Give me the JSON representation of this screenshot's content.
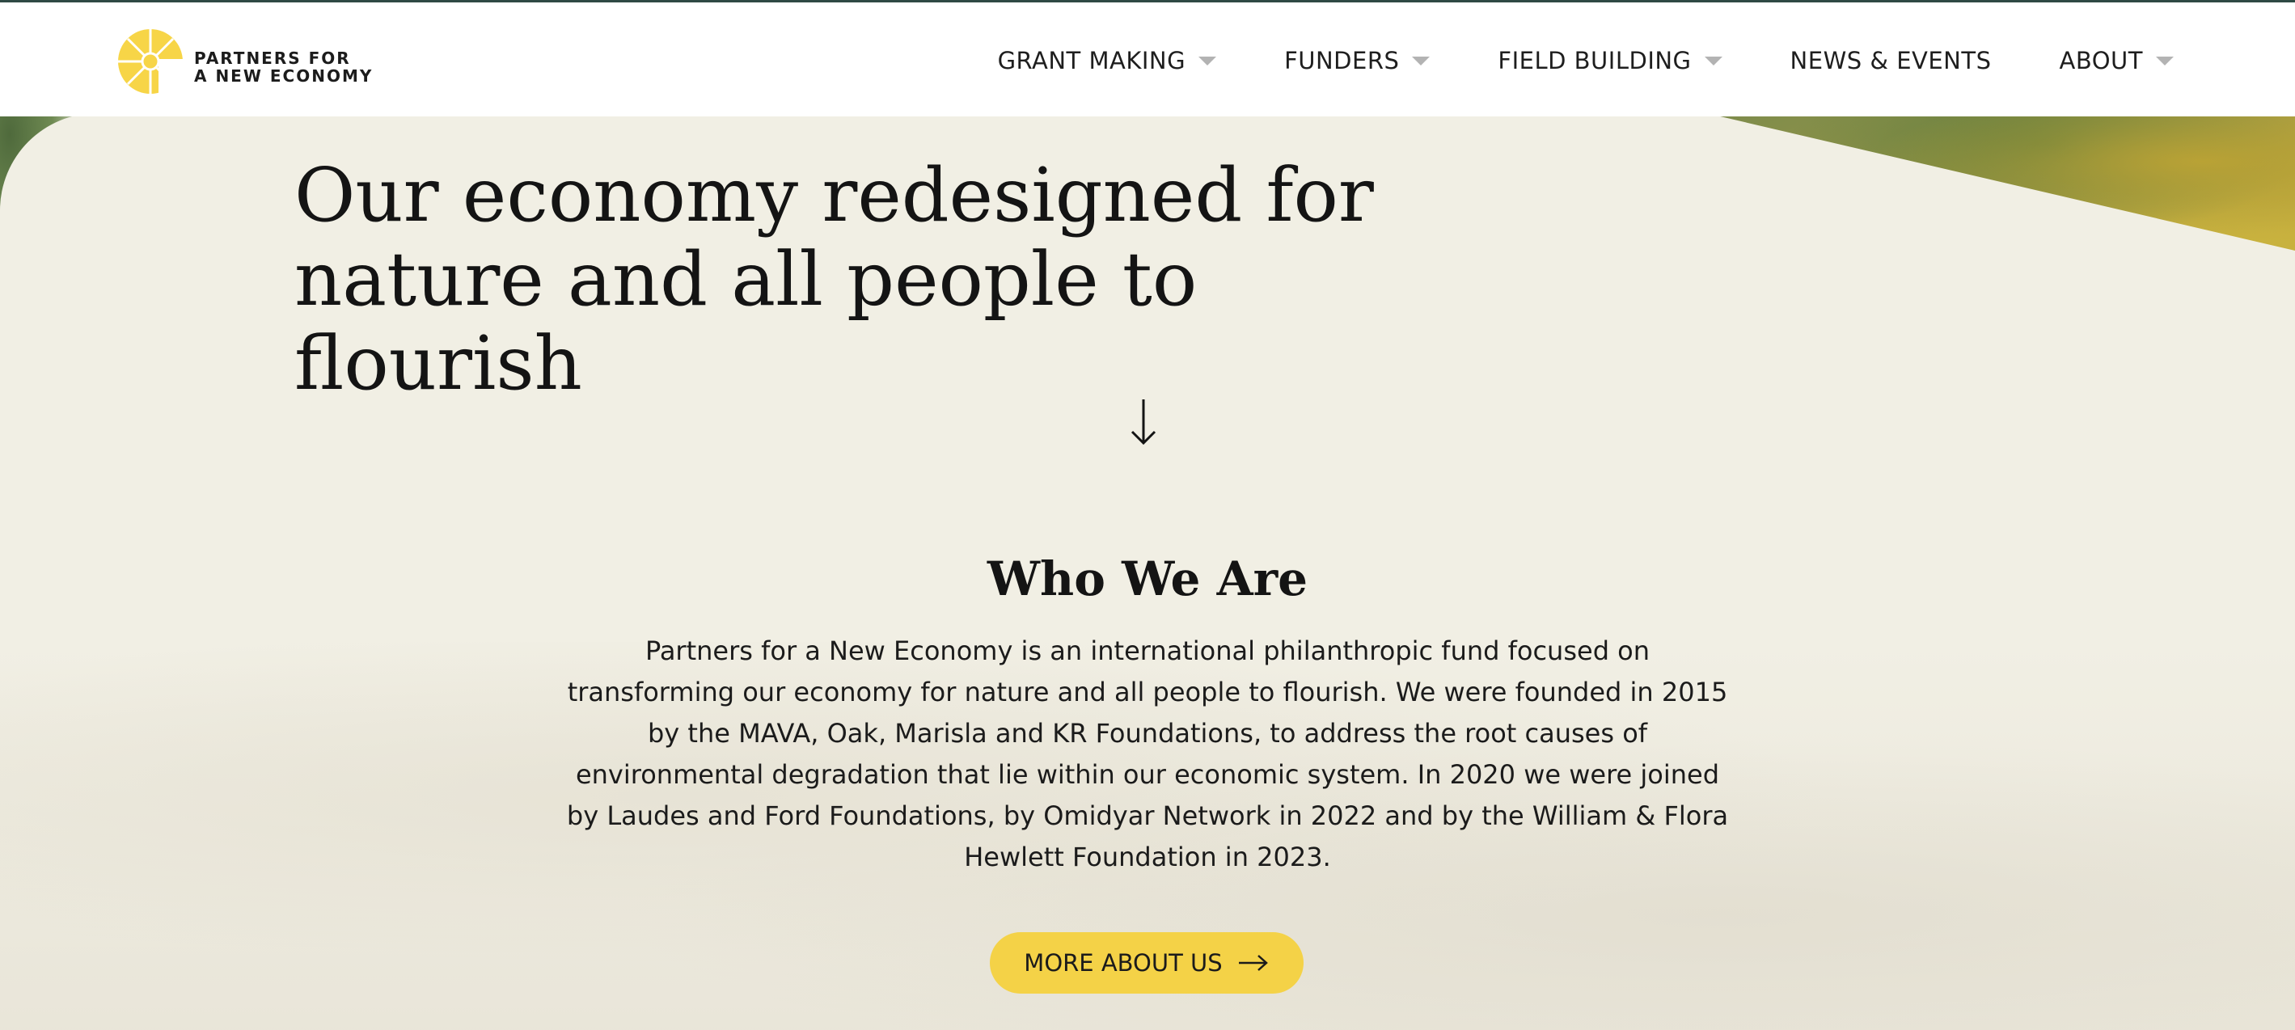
{
  "brand": {
    "name_line1": "PARTNERS FOR",
    "name_line2": "A NEW ECONOMY",
    "logo_color": "#f7d547"
  },
  "nav": {
    "items": [
      {
        "label": "GRANT MAKING",
        "has_dropdown": true
      },
      {
        "label": "FUNDERS",
        "has_dropdown": true
      },
      {
        "label": "FIELD BUILDING",
        "has_dropdown": true
      },
      {
        "label": "NEWS & EVENTS",
        "has_dropdown": false
      },
      {
        "label": "ABOUT",
        "has_dropdown": true
      }
    ]
  },
  "hero": {
    "title_line1": "Our economy redesigned for",
    "title_line2": "nature and all people to flourish",
    "scroll_icon": "arrow-down-icon"
  },
  "who": {
    "heading": "Who We Are",
    "body": "Partners for a New Economy is an international philanthropic fund focused on transforming our economy for nature and all people to flourish. We were founded in 2015 by the MAVA, Oak, Marisla and KR Foundations, to address the root causes of environmental degradation that lie within our economic system. In 2020 we were joined by Laudes and Ford Foundations, by Omidyar Network in 2022 and by the William & Flora Hewlett Foundation in 2023.",
    "cta_label": "MORE ABOUT US",
    "cta_icon": "arrow-right-icon",
    "cta_color": "#f4d247"
  },
  "colors": {
    "background": "#f1efe4",
    "header_bg": "#ffffff",
    "text": "#141414"
  }
}
